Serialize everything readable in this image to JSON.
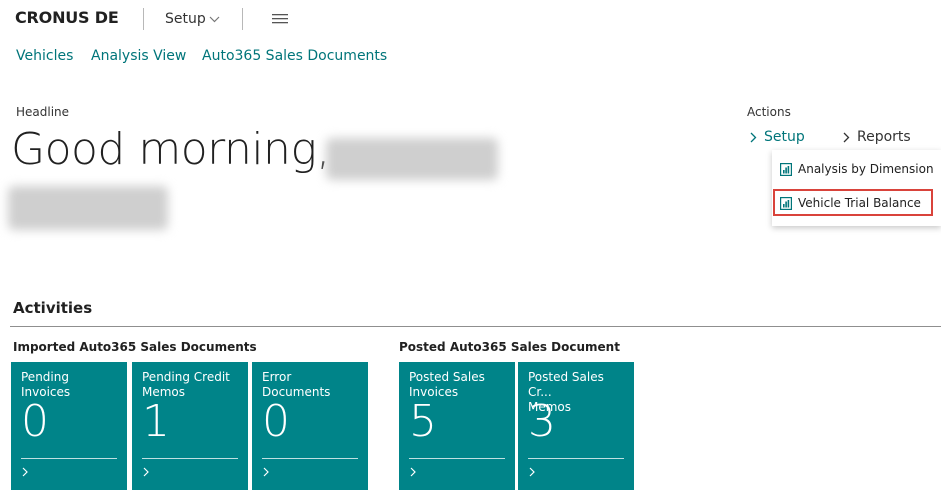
{
  "app": {
    "company": "CRONUS DE",
    "setup_menu": "Setup"
  },
  "nav": {
    "links": [
      "Vehicles",
      "Analysis View",
      "Auto365 Sales Documents"
    ]
  },
  "headline": {
    "label": "Headline",
    "greeting": "Good morning,"
  },
  "actions": {
    "label": "Actions",
    "setup": "Setup",
    "reports": "Reports",
    "dropdown": [
      "Analysis by Dimension",
      "Vehicle Trial Balance"
    ]
  },
  "activities": {
    "title": "Activities",
    "groups": [
      {
        "title": "Imported Auto365 Sales Documents",
        "tiles": [
          {
            "label": "Pending\nInvoices",
            "value": "0"
          },
          {
            "label": "Pending Credit\nMemos",
            "value": "1"
          },
          {
            "label": "Error\nDocuments",
            "value": "0"
          }
        ]
      },
      {
        "title": "Posted Auto365 Sales Document",
        "tiles": [
          {
            "label": "Posted Sales\nInvoices",
            "value": "5"
          },
          {
            "label": "Posted Sales Cr...\nMemos",
            "value": "3"
          }
        ]
      }
    ]
  },
  "colors": {
    "accent": "#00757a",
    "tile": "#008489",
    "highlight": "#d9433b"
  }
}
